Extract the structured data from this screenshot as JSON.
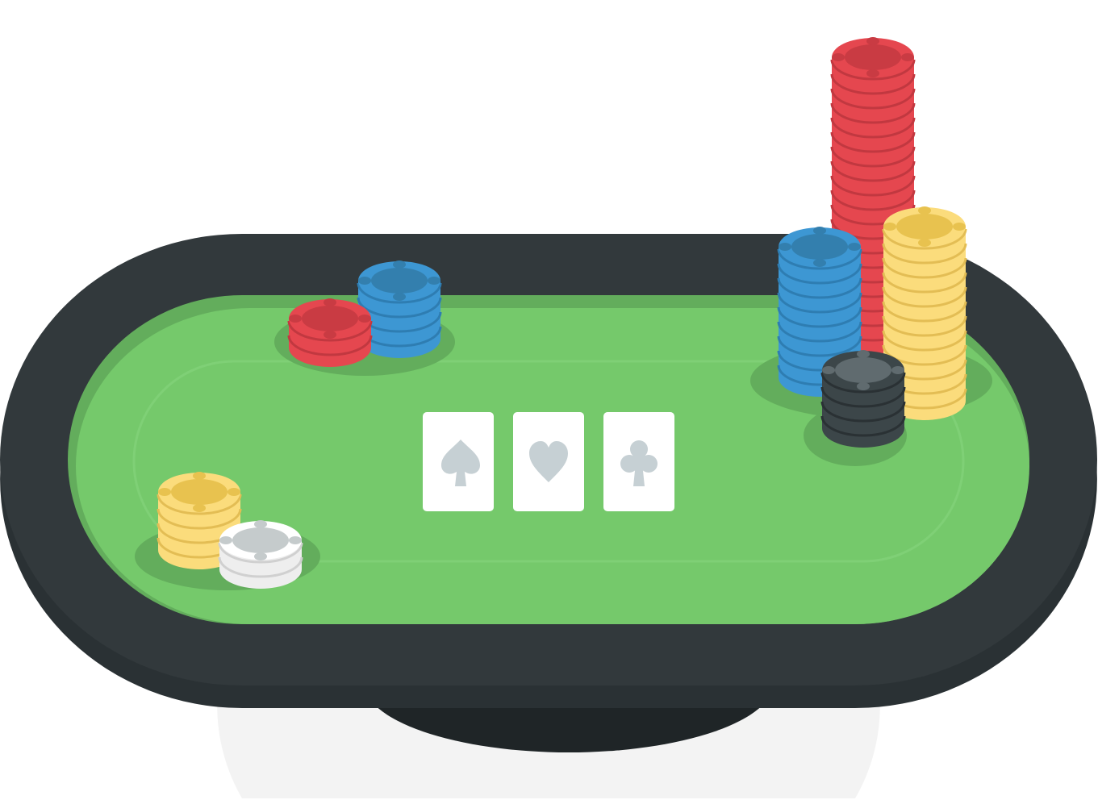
{
  "scene": {
    "subject": "poker-table",
    "colors": {
      "background": "#ffffff",
      "floor_shadow": "#f3f3f3",
      "table_base": "#1f2527",
      "rail_edge": "#2a3134",
      "rail": "#32393c",
      "felt_shade": "#63ad5c",
      "felt": "#75c96b",
      "felt_line": "#7fd076",
      "felt_shadow": "#63ad5c",
      "card_face": "#ffffff",
      "card_suit": "#c6d0d4"
    }
  },
  "community_cards": [
    {
      "suit": "spade-icon"
    },
    {
      "suit": "heart-icon"
    },
    {
      "suit": "club-icon"
    }
  ],
  "chip_colors": {
    "red": {
      "body": "#e5474f",
      "dark": "#c93b43",
      "top": "#e5474f",
      "center": "#c93b43",
      "line": "#c13840"
    },
    "blue": {
      "body": "#3d97d3",
      "dark": "#2d7fb6",
      "top": "#3d97d3",
      "center": "#337fae",
      "line": "#2e7db2"
    },
    "yellow": {
      "body": "#fbdc7c",
      "dark": "#e8c24f",
      "top": "#fbdc7c",
      "center": "#e8c24f",
      "line": "#e3bd54"
    },
    "white": {
      "body": "#eeeeee",
      "dark": "#d7d7d7",
      "top": "#ffffff",
      "center": "#c5cbcc",
      "line": "#d0d0d0"
    },
    "black": {
      "body": "#3c4649",
      "dark": "#2c3437",
      "top": "#3c4649",
      "center": "#606b6f",
      "line": "#2a3134"
    }
  },
  "chip_groups": [
    {
      "name": "chip-group-top-left",
      "stacks": [
        {
          "color": "blue",
          "chips": 5
        },
        {
          "color": "red",
          "chips": 3
        }
      ]
    },
    {
      "name": "chip-group-bottom-left",
      "stacks": [
        {
          "color": "yellow",
          "chips": 5
        },
        {
          "color": "white",
          "chips": 3
        }
      ]
    },
    {
      "name": "chip-group-right",
      "stacks": [
        {
          "color": "red",
          "chips": 22
        },
        {
          "color": "blue",
          "chips": 10
        },
        {
          "color": "yellow",
          "chips": 13
        },
        {
          "color": "black",
          "chips": 5
        }
      ]
    }
  ]
}
